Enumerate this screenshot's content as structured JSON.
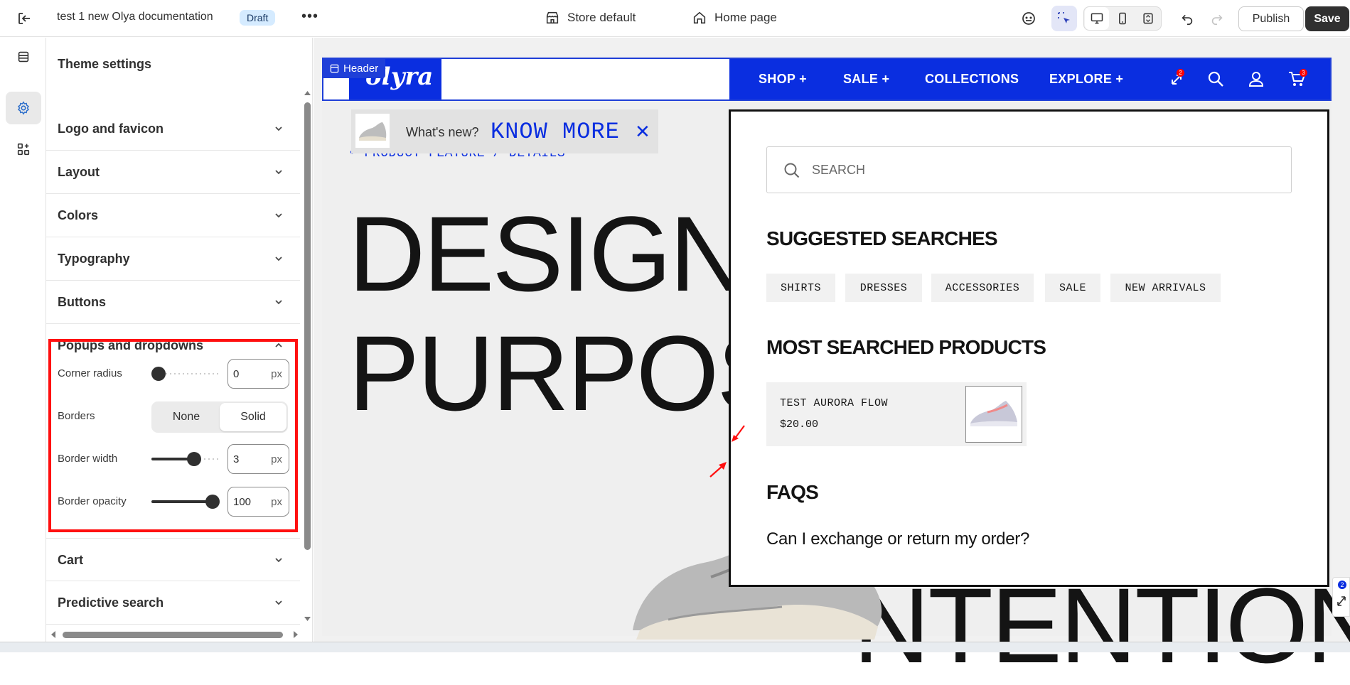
{
  "topbar": {
    "doc_title": "test 1 new Olya documentation",
    "status_badge": "Draft",
    "more_label": "•••",
    "store_label": "Store default",
    "page_label": "Home page",
    "publish_label": "Publish",
    "save_label": "Save"
  },
  "panel": {
    "title": "Theme settings",
    "sections": [
      {
        "label": "Logo and favicon",
        "expanded": false
      },
      {
        "label": "Layout",
        "expanded": false
      },
      {
        "label": "Colors",
        "expanded": false
      },
      {
        "label": "Typography",
        "expanded": false
      },
      {
        "label": "Buttons",
        "expanded": false
      },
      {
        "label": "Popups and dropdowns",
        "expanded": true
      },
      {
        "label": "Cart",
        "expanded": false
      },
      {
        "label": "Predictive search",
        "expanded": false
      }
    ],
    "popups": {
      "corner_radius_label": "Corner radius",
      "corner_radius_value": "0",
      "corner_radius_unit": "px",
      "borders_label": "Borders",
      "borders_options": [
        "None",
        "Solid"
      ],
      "borders_selected": "Solid",
      "border_width_label": "Border width",
      "border_width_value": "3",
      "border_width_unit": "px",
      "border_opacity_label": "Border opacity",
      "border_opacity_value": "100",
      "border_opacity_unit": "px"
    }
  },
  "preview": {
    "header_tag": "Header",
    "logo_text": "olyra",
    "nav": [
      "SHOP +",
      "SALE +",
      "COLLECTIONS",
      "EXPLORE +"
    ],
    "compare_badge": "2",
    "cart_badge": "3",
    "announcement": {
      "text": "What's new?",
      "cta": "KNOW MORE",
      "close": "✕"
    },
    "breadcrumb": "• PRODUCT FEATURE / DETAILS",
    "hero_line1": "DESIGNE",
    "hero_line2": "PURPOS",
    "hero_line3": "NTENTION",
    "search": {
      "placeholder": "SEARCH",
      "suggested_title": "SUGGESTED SEARCHES",
      "suggestions": [
        "SHIRTS",
        "DRESSES",
        "ACCESSORIES",
        "SALE",
        "NEW ARRIVALS"
      ],
      "products_title": "MOST SEARCHED PRODUCTS",
      "product_name": "TEST AURORA FLOW",
      "product_price": "$20.00",
      "faqs_title": "FAQS",
      "faq_question": "Can I exchange or return my order?"
    },
    "side_badge": "2"
  },
  "colors": {
    "brand_blue": "#0a2ee0",
    "highlight_red": "#ff1010",
    "badge_blue": "#d5ebff"
  }
}
